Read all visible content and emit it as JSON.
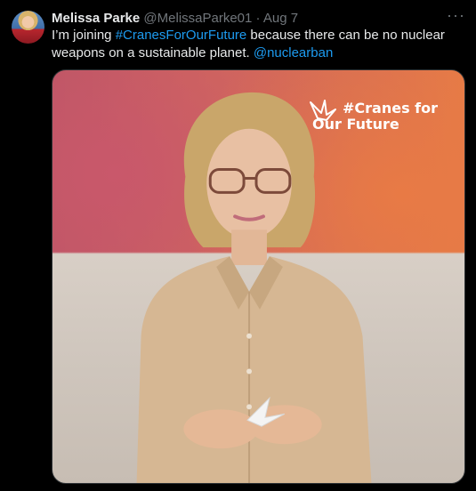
{
  "author": {
    "name": "Melissa Parke",
    "handle": "@MelissaParke01",
    "separator": "·",
    "date": "Aug 7"
  },
  "tweet": {
    "text_before": "I’m joining ",
    "hashtag": "#CranesForOurFuture",
    "text_after": " because there can be no nuclear weapons on a sustainable planet. ",
    "mention": "@nuclearban"
  },
  "more_label": "···",
  "media": {
    "logo_line1": "#Cranes for",
    "logo_line2": "Our Future"
  },
  "colors": {
    "background": "#000000",
    "text": "#e7e9ea",
    "muted": "#71767b",
    "link": "#1d9bf0"
  },
  "icons": [
    "more-options-icon",
    "crane-logo-icon"
  ]
}
